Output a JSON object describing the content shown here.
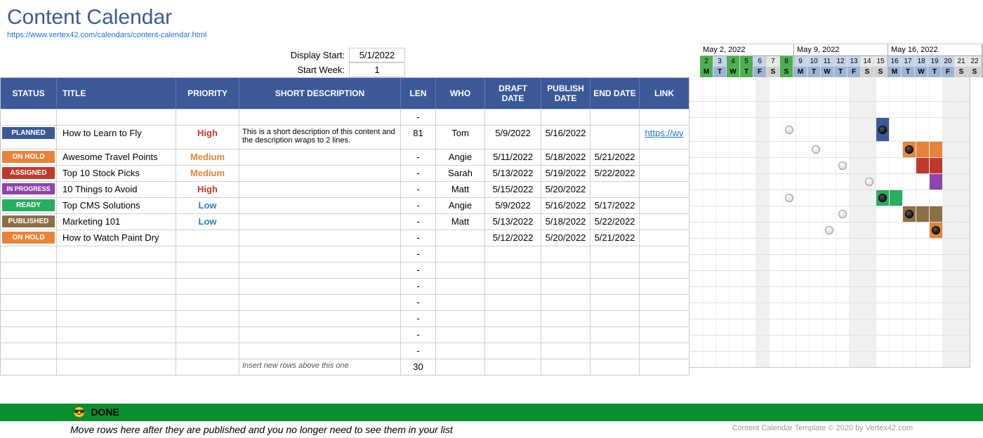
{
  "title": "Content Calendar",
  "url": "https://www.vertex42.com/calendars/content-calendar.html",
  "controls": {
    "display_start_label": "Display Start:",
    "display_start": "5/1/2022",
    "start_week_label": "Start Week:",
    "start_week": "1"
  },
  "headers": {
    "status": "STATUS",
    "title": "TITLE",
    "priority": "PRIORITY",
    "desc": "SHORT DESCRIPTION",
    "len": "LEN",
    "who": "WHO",
    "draft": "DRAFT DATE",
    "pub": "PUBLISH DATE",
    "end": "END DATE",
    "link": "LINK"
  },
  "weeks": [
    {
      "label": "May 2, 2022",
      "days": [
        {
          "n": "2",
          "l": "M",
          "grn": true
        },
        {
          "n": "3",
          "l": "T"
        },
        {
          "n": "4",
          "l": "W",
          "grn": true
        },
        {
          "n": "5",
          "l": "T",
          "grn": true
        },
        {
          "n": "6",
          "l": "F"
        },
        {
          "n": "7",
          "l": "S",
          "wknd": true
        },
        {
          "n": "8",
          "l": "S",
          "grn": true
        }
      ]
    },
    {
      "label": "May 9, 2022",
      "days": [
        {
          "n": "9",
          "l": "M"
        },
        {
          "n": "10",
          "l": "T"
        },
        {
          "n": "11",
          "l": "W"
        },
        {
          "n": "12",
          "l": "T"
        },
        {
          "n": "13",
          "l": "F"
        },
        {
          "n": "14",
          "l": "S",
          "wknd": true
        },
        {
          "n": "15",
          "l": "S",
          "wknd": true
        }
      ]
    },
    {
      "label": "May 16, 2022",
      "days": [
        {
          "n": "16",
          "l": "M"
        },
        {
          "n": "17",
          "l": "T"
        },
        {
          "n": "18",
          "l": "W"
        },
        {
          "n": "19",
          "l": "T"
        },
        {
          "n": "20",
          "l": "F"
        },
        {
          "n": "21",
          "l": "S",
          "wknd": true
        },
        {
          "n": "22",
          "l": "S",
          "wknd": true
        }
      ]
    }
  ],
  "rows": [
    {
      "status": "",
      "title": "",
      "priority": "",
      "desc": "",
      "len": "-",
      "who": "",
      "draft": "",
      "pub": "",
      "end": "",
      "link": "",
      "gantt": []
    },
    {
      "status": "PLANNED",
      "badge": "b-planned",
      "title": "How to Learn to Fly",
      "priority": "High",
      "pcls": "pri-high",
      "desc": "This is a short description of this content and the description wraps to 2 lines.",
      "len": "81",
      "who": "Tom",
      "draft": "5/9/2022",
      "pub": "5/16/2022",
      "end": "",
      "link": "https://wv",
      "tall": true,
      "gantt": [
        {
          "i": 7,
          "dot": "grey"
        },
        {
          "i": 14,
          "dot": "black"
        },
        {
          "i": 14,
          "bar": "bar-planned"
        }
      ]
    },
    {
      "status": "ON HOLD",
      "badge": "b-onhold",
      "title": "Awesome Travel Points",
      "priority": "Medium",
      "pcls": "pri-med",
      "desc": "",
      "len": "-",
      "who": "Angie",
      "draft": "5/11/2022",
      "pub": "5/18/2022",
      "end": "5/21/2022",
      "link": "",
      "gantt": [
        {
          "i": 9,
          "dot": "grey"
        },
        {
          "i": 16,
          "dot": "black"
        },
        {
          "i": 16,
          "bar": "bar-onhold"
        },
        {
          "i": 17,
          "bar": "bar-onhold"
        },
        {
          "i": 18,
          "bar": "bar-onhold"
        },
        {
          "i": 19,
          "bar": "bar-onhold"
        }
      ]
    },
    {
      "status": "ASSIGNED",
      "badge": "b-assigned",
      "title": "Top 10 Stock Picks",
      "priority": "Medium",
      "pcls": "pri-med",
      "desc": "",
      "len": "-",
      "who": "Sarah",
      "draft": "5/13/2022",
      "pub": "5/19/2022",
      "end": "5/22/2022",
      "link": "",
      "gantt": [
        {
          "i": 11,
          "dot": "grey"
        },
        {
          "i": 17,
          "bar": "bar-assigned"
        },
        {
          "i": 18,
          "bar": "bar-assigned"
        },
        {
          "i": 19,
          "bar": "bar-assigned"
        },
        {
          "i": 20,
          "bar": "bar-assigned"
        }
      ]
    },
    {
      "status": "IN PROGRESS",
      "badge": "b-inprogress",
      "title": "10 Things to Avoid",
      "priority": "High",
      "pcls": "pri-high",
      "desc": "",
      "len": "-",
      "who": "Matt",
      "draft": "5/15/2022",
      "pub": "5/20/2022",
      "end": "",
      "link": "",
      "gantt": [
        {
          "i": 13,
          "dot": "grey"
        },
        {
          "i": 18,
          "bar": "bar-inprogress"
        }
      ]
    },
    {
      "status": "READY",
      "badge": "b-ready",
      "title": "Top CMS Solutions",
      "priority": "Low",
      "pcls": "pri-low",
      "desc": "",
      "len": "-",
      "who": "Angie",
      "draft": "5/9/2022",
      "pub": "5/16/2022",
      "end": "5/17/2022",
      "link": "",
      "gantt": [
        {
          "i": 7,
          "dot": "grey"
        },
        {
          "i": 14,
          "dot": "black"
        },
        {
          "i": 14,
          "bar": "bar-ready"
        },
        {
          "i": 15,
          "bar": "bar-ready"
        }
      ]
    },
    {
      "status": "PUBLISHED",
      "badge": "b-published",
      "title": "Marketing 101",
      "priority": "Low",
      "pcls": "pri-low",
      "desc": "",
      "len": "-",
      "who": "Matt",
      "draft": "5/13/2022",
      "pub": "5/18/2022",
      "end": "5/22/2022",
      "link": "",
      "gantt": [
        {
          "i": 11,
          "dot": "grey"
        },
        {
          "i": 16,
          "dot": "black"
        },
        {
          "i": 16,
          "bar": "bar-published"
        },
        {
          "i": 17,
          "bar": "bar-published"
        },
        {
          "i": 18,
          "bar": "bar-published"
        },
        {
          "i": 19,
          "bar": "bar-published"
        },
        {
          "i": 20,
          "bar": "bar-published"
        }
      ]
    },
    {
      "status": "ON HOLD",
      "badge": "b-onhold",
      "title": "How to Watch Paint Dry",
      "priority": "",
      "desc": "",
      "len": "-",
      "who": "",
      "draft": "5/12/2022",
      "pub": "5/20/2022",
      "end": "5/21/2022",
      "link": "",
      "gantt": [
        {
          "i": 10,
          "dot": "grey"
        },
        {
          "i": 18,
          "dot": "black"
        },
        {
          "i": 18,
          "bar": "bar-onhold"
        },
        {
          "i": 19,
          "bar": "bar-onhold"
        }
      ]
    },
    {
      "len": "-",
      "gantt": []
    },
    {
      "len": "-",
      "gantt": []
    },
    {
      "len": "-",
      "gantt": []
    },
    {
      "len": "-",
      "gantt": []
    },
    {
      "len": "-",
      "gantt": []
    },
    {
      "len": "-",
      "gantt": []
    },
    {
      "len": "-",
      "gantt": []
    },
    {
      "desc": "Insert new rows above this one",
      "len": "30",
      "insert": true,
      "gantt": []
    }
  ],
  "done": {
    "emoji": "😎",
    "label": "DONE",
    "note": "Move rows here after they are published and you no longer need to see them in your list",
    "copyright": "Content Calendar Template © 2020 by Vertex42.com"
  }
}
